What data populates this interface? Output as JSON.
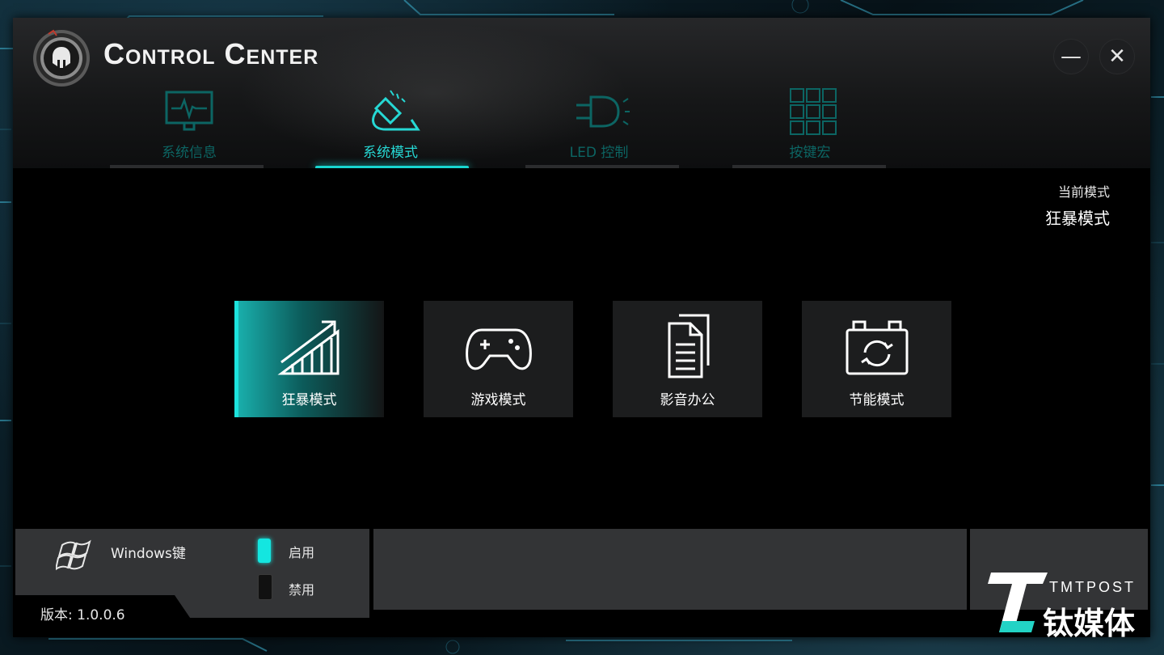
{
  "app": {
    "title": "Control Center"
  },
  "window_controls": {
    "minimize": "—",
    "close": "✕"
  },
  "tabs": [
    {
      "label": "系统信息",
      "icon": "monitor-pulse-icon",
      "active": false
    },
    {
      "label": "系统模式",
      "icon": "mode-switch-icon",
      "active": true
    },
    {
      "label": "LED 控制",
      "icon": "led-bulb-icon",
      "active": false
    },
    {
      "label": "按键宏",
      "icon": "keypad-icon",
      "active": false
    }
  ],
  "current_mode": {
    "label": "当前模式",
    "value": "狂暴模式"
  },
  "modes": [
    {
      "label": "狂暴模式",
      "icon": "performance-chart-icon",
      "active": true
    },
    {
      "label": "游戏模式",
      "icon": "gamepad-icon",
      "active": false
    },
    {
      "label": "影音办公",
      "icon": "document-icon",
      "active": false
    },
    {
      "label": "节能模式",
      "icon": "battery-cycle-icon",
      "active": false
    }
  ],
  "windows_key": {
    "label": "Windows键",
    "enable_label": "启用",
    "disable_label": "禁用",
    "state": "启用"
  },
  "version": "版本: 1.0.0.6",
  "watermark": {
    "en": "TMTPOST",
    "cn": "钛媒体"
  },
  "colors": {
    "accent": "#18d6d0",
    "accent_dim": "#0c6563",
    "panel": "#333436"
  }
}
